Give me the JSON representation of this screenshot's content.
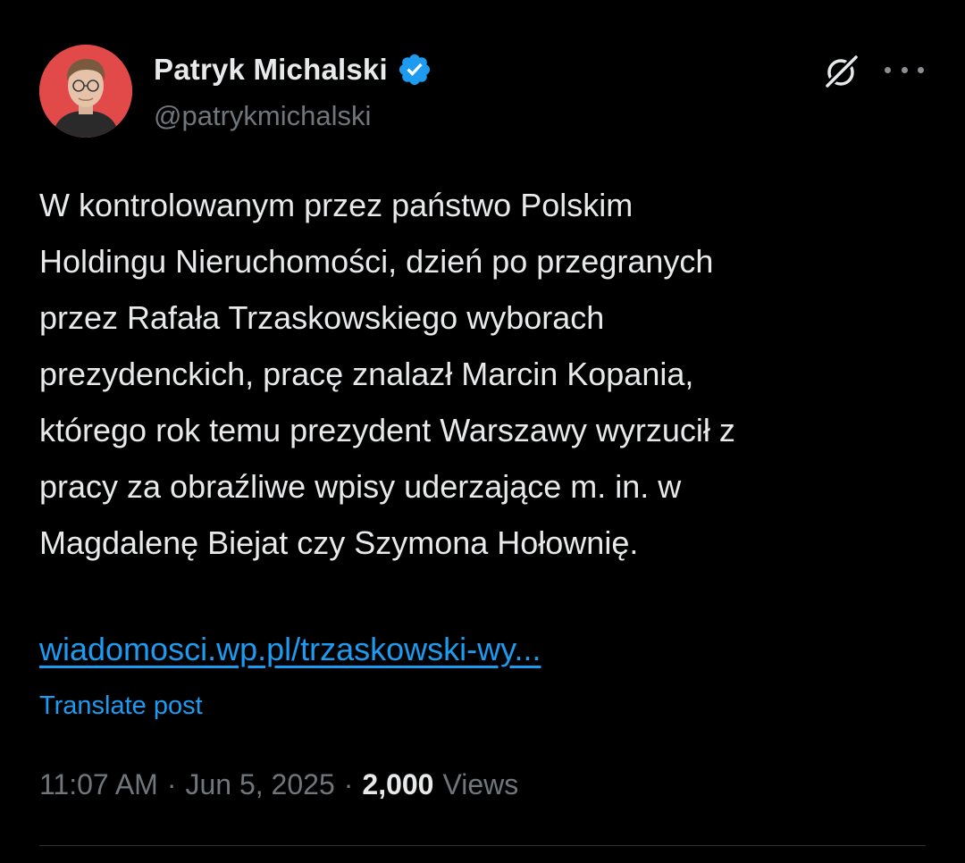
{
  "author": {
    "display_name": "Patryk Michalski",
    "handle": "@patrykmichalski",
    "verified": true,
    "avatar_background": "#e24a4a"
  },
  "actions": {
    "grok_icon": "grok-icon",
    "more_icon": "more-horizontal-icon"
  },
  "post": {
    "text": "W kontrolowanym przez państwo Polskim\nHoldingu Nieruchomości, dzień po przegranych\nprzez Rafała Trzaskowskiego wyborach\nprezydenckich, pracę znalazł Marcin Kopania,\nktórego rok temu prezydent Warszawy wyrzucił z\npracy za obraźliwe wpisy uderzające m. in. w\nMagdalenę Biejat czy Szymona Hołownię.",
    "link_text": "wiadomosci.wp.pl/trzaskowski-wy...",
    "translate_label": "Translate post"
  },
  "meta": {
    "time": "11:07 AM",
    "separator": "·",
    "date": "Jun 5, 2025",
    "views_count": "2,000",
    "views_label": "Views"
  },
  "colors": {
    "background": "#000000",
    "text_primary": "#e7e9ea",
    "text_secondary": "#71767b",
    "accent": "#1d9bf0"
  }
}
